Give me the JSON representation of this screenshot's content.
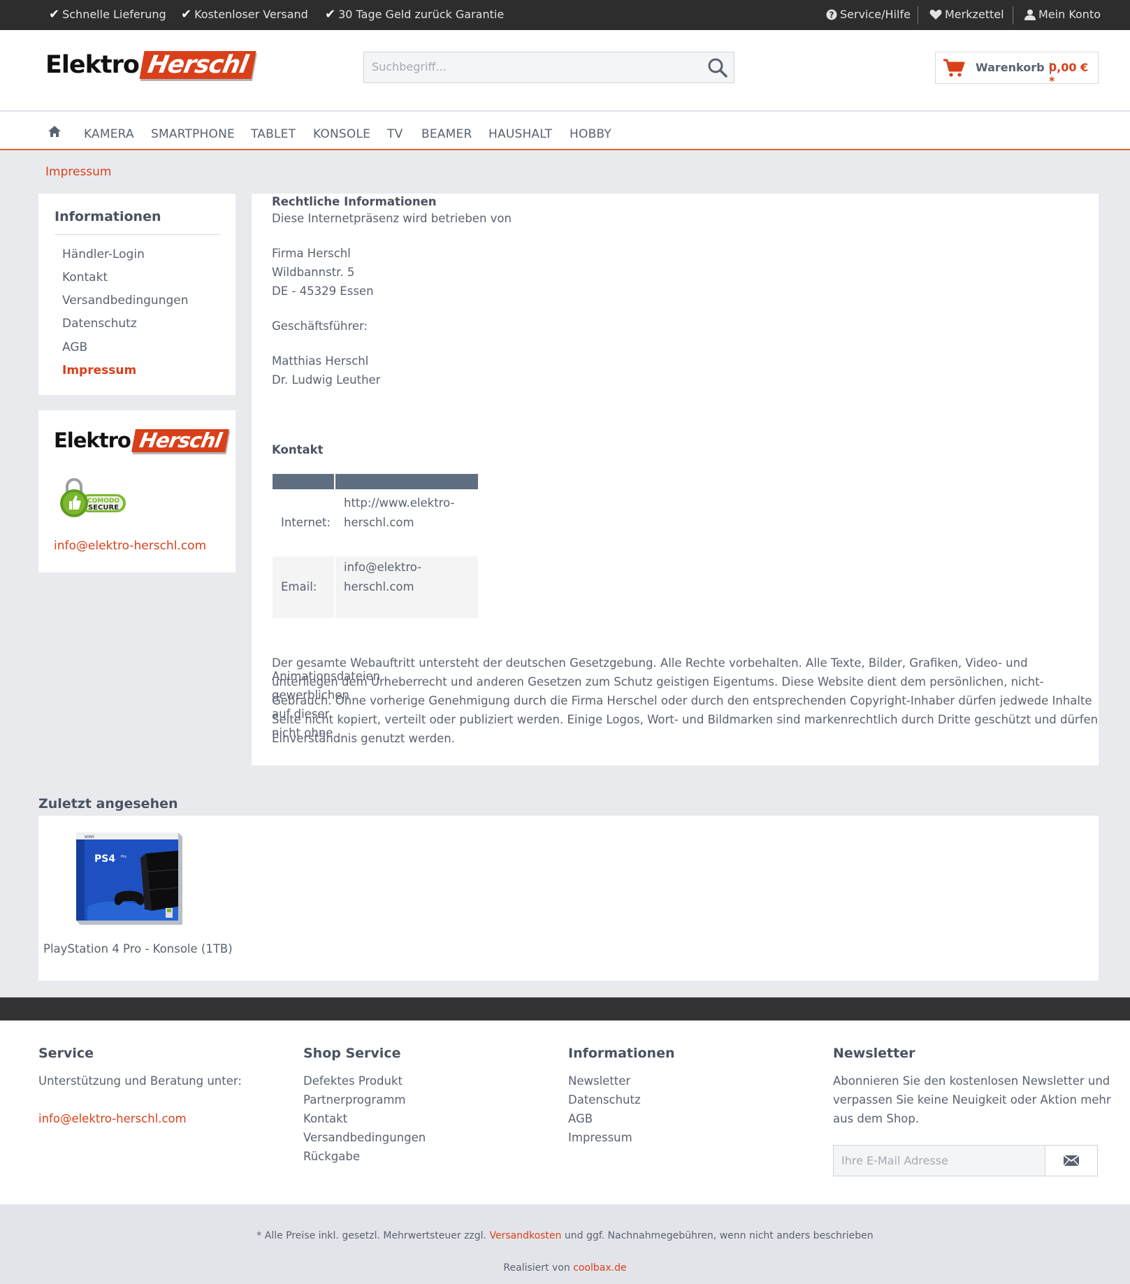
{
  "topbar": {
    "usps": [
      "Schnelle Lieferung",
      "Kostenloser Versand",
      "30 Tage Geld zurück Garantie"
    ],
    "service": "Service/Hilfe",
    "wishlist": "Merkzettel",
    "account": "Mein Konto"
  },
  "header": {
    "logo_part1": "Elektro",
    "logo_part2": "Herschl",
    "search_placeholder": "Suchbegriff...",
    "cart_label": "Warenkorb |",
    "cart_price": "0,00 € *"
  },
  "nav": {
    "items": [
      "KAMERA",
      "SMARTPHONE",
      "TABLET",
      "KONSOLE",
      "TV",
      "BEAMER",
      "HAUSHALT",
      "HOBBY"
    ]
  },
  "breadcrumb": "Impressum",
  "sidebar": {
    "title": "Informationen",
    "items": [
      "Händler-Login",
      "Kontakt",
      "Versandbedingungen",
      "Datenschutz",
      "AGB",
      "Impressum"
    ],
    "seal_text_1": "COMODO",
    "seal_text_2": "SECURE",
    "email": "info@elektro-herschl.com"
  },
  "content": {
    "heading": "Rechtliche Informationen",
    "intro": "Diese Internetpräsenz wird betrieben von",
    "company": "Firma Herschl",
    "street": "Wildbannstr. 5",
    "city": "DE - 45329 Essen",
    "ceo_label": "Geschäftsführer:",
    "ceo_1": "Matthias Herschl",
    "ceo_2": "Dr. Ludwig Leuther",
    "contact_heading": "Kontakt",
    "contact_rows": [
      {
        "label": "Internet:",
        "value_1": "http://www.elektro-",
        "value_2": "herschl.com"
      },
      {
        "label": "Email:",
        "value_1": "info@elektro-",
        "value_2": "herschl.com"
      }
    ],
    "legal_lines": [
      "Der gesamte Webauftritt untersteht der deutschen Gesetzgebung. Alle Rechte vorbehalten. Alle Texte, Bilder, Grafiken, Video- und Animationsdateien",
      "unterliegen dem Urheberrecht und anderen Gesetzen zum Schutz geistigen Eigentums. Diese Website dient dem persönlichen, nicht-gewerblichen",
      "Gebrauch. Ohne vorherige Genehmigung durch die Firma Herschel oder durch den entsprechenden Copyright-Inhaber dürfen jedwede Inhalte auf dieser",
      "Seite nicht kopiert, verteilt oder publiziert werden. Einige Logos, Wort- und Bildmarken sind markenrechtlich durch Dritte geschützt und dürfen nicht ohne",
      "Einverständnis genutzt werden."
    ]
  },
  "last_viewed": {
    "title": "Zuletzt angesehen",
    "product_name": "PlayStation 4 Pro - Konsole (1TB)",
    "box_brand": "SONY",
    "box_logo": "PS4",
    "box_variant": "Pro"
  },
  "footer": {
    "service_title": "Service",
    "service_text": "Unterstützung und Beratung unter:",
    "service_email": "info@elektro-herschl.com",
    "shop_title": "Shop Service",
    "shop_items": [
      "Defektes Produkt",
      "Partnerprogramm",
      "Kontakt",
      "Versandbedingungen",
      "Rückgabe"
    ],
    "info_title": "Informationen",
    "info_items": [
      "Newsletter",
      "Datenschutz",
      "AGB",
      "Impressum"
    ],
    "newsletter_title": "Newsletter",
    "newsletter_lines": [
      "Abonnieren Sie den kostenlosen Newsletter und",
      "verpassen Sie keine Neuigkeit oder Aktion mehr",
      "aus dem Shop."
    ],
    "newsletter_placeholder": "Ihre E-Mail Adresse"
  },
  "bottom": {
    "vat_pre": "* Alle Preise inkl. gesetzl. Mehrwertsteuer zzgl.",
    "vat_link": "Versandkosten",
    "vat_post": "und ggf. Nachnahmegebühren, wenn nicht anders beschrieben",
    "realized_pre": "Realisiert von",
    "realized_link": "coolbax.de"
  },
  "colors": {
    "accent": "#d9401a",
    "topbar": "#2d2d2d",
    "table_header": "#5f6e80"
  }
}
